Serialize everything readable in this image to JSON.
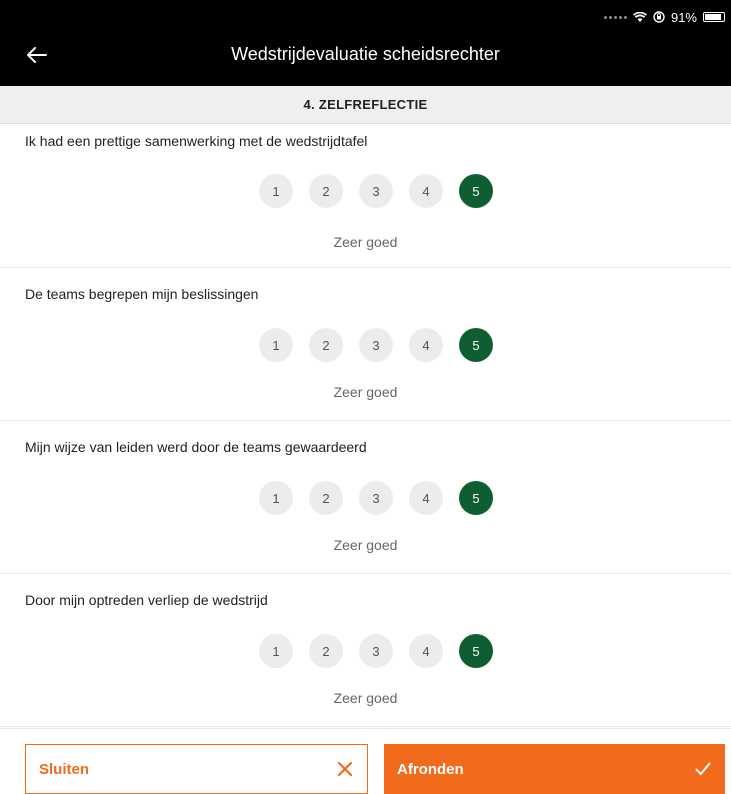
{
  "status_bar": {
    "battery_text": "91%",
    "battery_level": 0.91
  },
  "header": {
    "title": "Wedstrijdevaluatie scheidsrechter"
  },
  "section": {
    "title": "4. ZELFREFLECTIE"
  },
  "questions": [
    {
      "text": "Ik had een prettige samenwerking met de wedstrijdtafel",
      "selected": 5,
      "caption": "Zeer goed"
    },
    {
      "text": "De teams begrepen mijn beslissingen",
      "selected": 5,
      "caption": "Zeer goed"
    },
    {
      "text": "Mijn wijze van leiden werd door de teams gewaardeerd",
      "selected": 5,
      "caption": "Zeer goed"
    },
    {
      "text": "Door mijn optreden verliep de wedstrijd",
      "selected": 5,
      "caption": "Zeer goed"
    }
  ],
  "rating_options": [
    "1",
    "2",
    "3",
    "4",
    "5"
  ],
  "footer": {
    "close_label": "Sluiten",
    "finish_label": "Afronden"
  },
  "colors": {
    "accent": "#f26a1b",
    "selected_rating": "#0f5e32"
  }
}
